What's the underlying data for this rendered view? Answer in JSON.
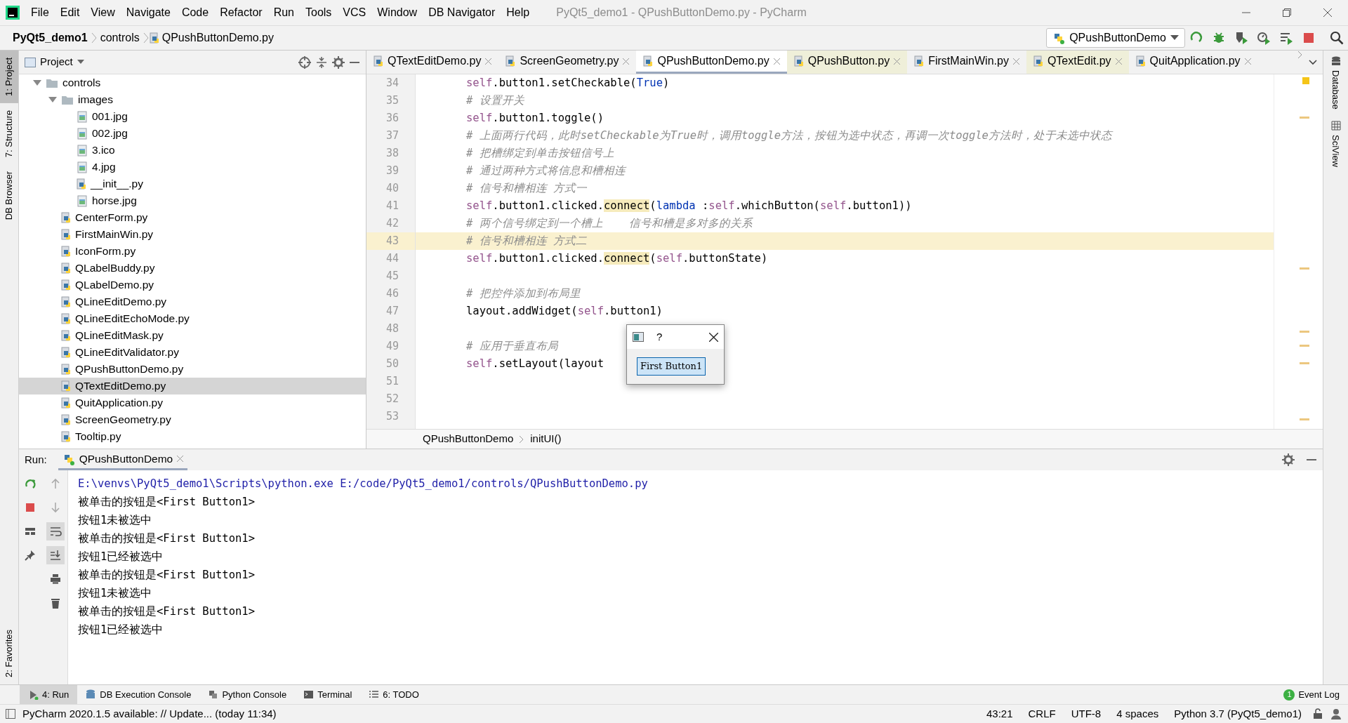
{
  "window": {
    "title": "PyQt5_demo1 - QPushButtonDemo.py - PyCharm"
  },
  "menu": [
    "File",
    "Edit",
    "View",
    "Navigate",
    "Code",
    "Refactor",
    "Run",
    "Tools",
    "VCS",
    "Window",
    "DB Navigator",
    "Help"
  ],
  "breadcrumbs": [
    "PyQt5_demo1",
    "controls",
    "QPushButtonDemo.py"
  ],
  "run_configuration": "QPushButtonDemo",
  "left_tool_windows": [
    {
      "label": "1: Project",
      "selected": true
    },
    {
      "label": "7: Structure",
      "selected": false
    },
    {
      "label": "DB Browser",
      "selected": false
    }
  ],
  "left_bottom_tool_windows": [
    {
      "label": "2: Favorites",
      "selected": false
    }
  ],
  "right_tool_windows": [
    "Database",
    "SciView"
  ],
  "project": {
    "title": "Project",
    "tree": [
      {
        "label": "controls",
        "kind": "folder",
        "expanded": true,
        "selected": false,
        "children": [
          {
            "label": "images",
            "kind": "folder",
            "expanded": true,
            "selected": false,
            "children": [
              {
                "label": "001.jpg",
                "kind": "image",
                "selected": false
              },
              {
                "label": "002.jpg",
                "kind": "image",
                "selected": false
              },
              {
                "label": "3.ico",
                "kind": "image",
                "selected": false
              },
              {
                "label": "4.jpg",
                "kind": "image",
                "selected": false
              },
              {
                "label": "__init__.py",
                "kind": "python",
                "selected": false
              },
              {
                "label": "horse.jpg",
                "kind": "image",
                "selected": false
              }
            ]
          },
          {
            "label": "CenterForm.py",
            "kind": "python",
            "selected": false
          },
          {
            "label": "FirstMainWin.py",
            "kind": "python",
            "selected": false
          },
          {
            "label": "IconForm.py",
            "kind": "python",
            "selected": false
          },
          {
            "label": "QLabelBuddy.py",
            "kind": "python",
            "selected": false
          },
          {
            "label": "QLabelDemo.py",
            "kind": "python",
            "selected": false
          },
          {
            "label": "QLineEditDemo.py",
            "kind": "python",
            "selected": false
          },
          {
            "label": "QLineEditEchoMode.py",
            "kind": "python",
            "selected": false
          },
          {
            "label": "QLineEditMask.py",
            "kind": "python",
            "selected": false
          },
          {
            "label": "QLineEditValidator.py",
            "kind": "python",
            "selected": false
          },
          {
            "label": "QPushButtonDemo.py",
            "kind": "python",
            "selected": false
          },
          {
            "label": "QTextEditDemo.py",
            "kind": "python",
            "selected": true
          },
          {
            "label": "QuitApplication.py",
            "kind": "python",
            "selected": false
          },
          {
            "label": "ScreenGeometry.py",
            "kind": "python",
            "selected": false
          },
          {
            "label": "Tooltip.py",
            "kind": "python",
            "selected": false
          }
        ]
      }
    ]
  },
  "editor_tabs": [
    {
      "label": "QTextEditDemo.py",
      "selected": false,
      "tinted": false
    },
    {
      "label": "ScreenGeometry.py",
      "selected": false,
      "tinted": false
    },
    {
      "label": "QPushButtonDemo.py",
      "selected": true,
      "tinted": false
    },
    {
      "label": "QPushButton.py",
      "selected": false,
      "tinted": true
    },
    {
      "label": "FirstMainWin.py",
      "selected": false,
      "tinted": false
    },
    {
      "label": "QTextEdit.py",
      "selected": false,
      "tinted": true
    },
    {
      "label": "QuitApplication.py",
      "selected": false,
      "tinted": false
    }
  ],
  "code_lines": [
    {
      "number": "34",
      "current": false,
      "segments": [
        {
          "text": "self",
          "kind": "self"
        },
        {
          "text": ".button1.setCheckable(",
          "kind": "plain"
        },
        {
          "text": "True",
          "kind": "keyword"
        },
        {
          "text": ")",
          "kind": "plain"
        }
      ]
    },
    {
      "number": "35",
      "current": false,
      "segments": [
        {
          "text": "# 设置开关",
          "kind": "comment"
        }
      ]
    },
    {
      "number": "36",
      "current": false,
      "segments": [
        {
          "text": "self",
          "kind": "self"
        },
        {
          "text": ".button1.toggle()",
          "kind": "plain"
        }
      ]
    },
    {
      "number": "37",
      "current": false,
      "segments": [
        {
          "text": "# 上面两行代码，此时setCheckable为True时，调用toggle方法，按钮为选中状态，再调一次toggle方法时，处于未选中状态",
          "kind": "comment"
        }
      ]
    },
    {
      "number": "38",
      "current": false,
      "segments": [
        {
          "text": "# 把槽绑定到单击按钮信号上",
          "kind": "comment"
        }
      ]
    },
    {
      "number": "39",
      "current": false,
      "segments": [
        {
          "text": "# 通过两种方式将信息和槽相连",
          "kind": "comment"
        }
      ]
    },
    {
      "number": "40",
      "current": false,
      "segments": [
        {
          "text": "# 信号和槽相连 方式一",
          "kind": "comment"
        }
      ]
    },
    {
      "number": "41",
      "current": false,
      "segments": [
        {
          "text": "self",
          "kind": "self"
        },
        {
          "text": ".button1.clicked.",
          "kind": "plain"
        },
        {
          "text": "connect",
          "kind": "highlight"
        },
        {
          "text": "(",
          "kind": "plain"
        },
        {
          "text": "lambda",
          "kind": "keyword"
        },
        {
          "text": " :",
          "kind": "plain"
        },
        {
          "text": "self",
          "kind": "self"
        },
        {
          "text": ".whichButton(",
          "kind": "plain"
        },
        {
          "text": "self",
          "kind": "self"
        },
        {
          "text": ".button1))",
          "kind": "plain"
        }
      ]
    },
    {
      "number": "42",
      "current": false,
      "segments": [
        {
          "text": "# 两个信号绑定到一个槽上    信号和槽是多对多的关系",
          "kind": "comment"
        }
      ]
    },
    {
      "number": "43",
      "current": true,
      "segments": [
        {
          "text": "# 信号和槽相连 方式二",
          "kind": "comment"
        }
      ]
    },
    {
      "number": "44",
      "current": false,
      "segments": [
        {
          "text": "self",
          "kind": "self"
        },
        {
          "text": ".button1.clicked.",
          "kind": "plain"
        },
        {
          "text": "connect",
          "kind": "highlight"
        },
        {
          "text": "(",
          "kind": "plain"
        },
        {
          "text": "self",
          "kind": "self"
        },
        {
          "text": ".buttonState)",
          "kind": "plain"
        }
      ]
    },
    {
      "number": "45",
      "current": false
    },
    {
      "number": "46",
      "current": false,
      "segments": [
        {
          "text": "# 把控件添加到布局里",
          "kind": "comment"
        }
      ]
    },
    {
      "number": "47",
      "current": false,
      "segments": [
        {
          "text": "layout.addWidget(",
          "kind": "plain"
        },
        {
          "text": "self",
          "kind": "self"
        },
        {
          "text": ".button1)",
          "kind": "plain"
        }
      ]
    },
    {
      "number": "48",
      "current": false
    },
    {
      "number": "49",
      "current": false,
      "segments": [
        {
          "text": "# 应用于垂直布局",
          "kind": "comment"
        }
      ]
    },
    {
      "number": "50",
      "current": false,
      "segments": [
        {
          "text": "self",
          "kind": "self"
        },
        {
          "text": ".setLayout(layout",
          "kind": "plain"
        }
      ]
    },
    {
      "number": "51",
      "current": false
    },
    {
      "number": "52",
      "current": false
    },
    {
      "number": "53",
      "current": false
    }
  ],
  "editor_breadcrumbs": [
    "QPushButtonDemo",
    "initUI()"
  ],
  "dialog": {
    "title": "?",
    "button": {
      "label": "First Button1",
      "checked": true
    }
  },
  "run_panel": {
    "label": "Run:",
    "tab": "QPushButtonDemo",
    "output": [
      {
        "text": "E:\\venvs\\PyQt5_demo1\\Scripts\\python.exe E:/code/PyQt5_demo1/controls/QPushButtonDemo.py",
        "kind": "command"
      },
      {
        "text": "被单击的按钮是<First Button1>",
        "kind": "output"
      },
      {
        "text": "按钮1未被选中",
        "kind": "output"
      },
      {
        "text": "被单击的按钮是<First Button1>",
        "kind": "output"
      },
      {
        "text": "按钮1已经被选中",
        "kind": "output"
      },
      {
        "text": "被单击的按钮是<First Button1>",
        "kind": "output"
      },
      {
        "text": "按钮1未被选中",
        "kind": "output"
      },
      {
        "text": "被单击的按钮是<First Button1>",
        "kind": "output"
      },
      {
        "text": "按钮1已经被选中",
        "kind": "output"
      }
    ]
  },
  "bottom_tool_windows": [
    {
      "label": "4: Run",
      "selected": true
    },
    {
      "label": "DB Execution Console",
      "selected": false
    },
    {
      "label": "Python Console",
      "selected": false
    },
    {
      "label": "Terminal",
      "selected": false
    },
    {
      "label": "6: TODO",
      "selected": false
    }
  ],
  "event_log": {
    "label": "Event Log",
    "count": "1"
  },
  "status_bar": {
    "message": "PyCharm 2020.1.5 available: // Update... (today 11:34)",
    "items": [
      "43:21",
      "CRLF",
      "UTF-8",
      "4 spaces",
      "Python 3.7 (PyQt5_demo1)"
    ]
  }
}
